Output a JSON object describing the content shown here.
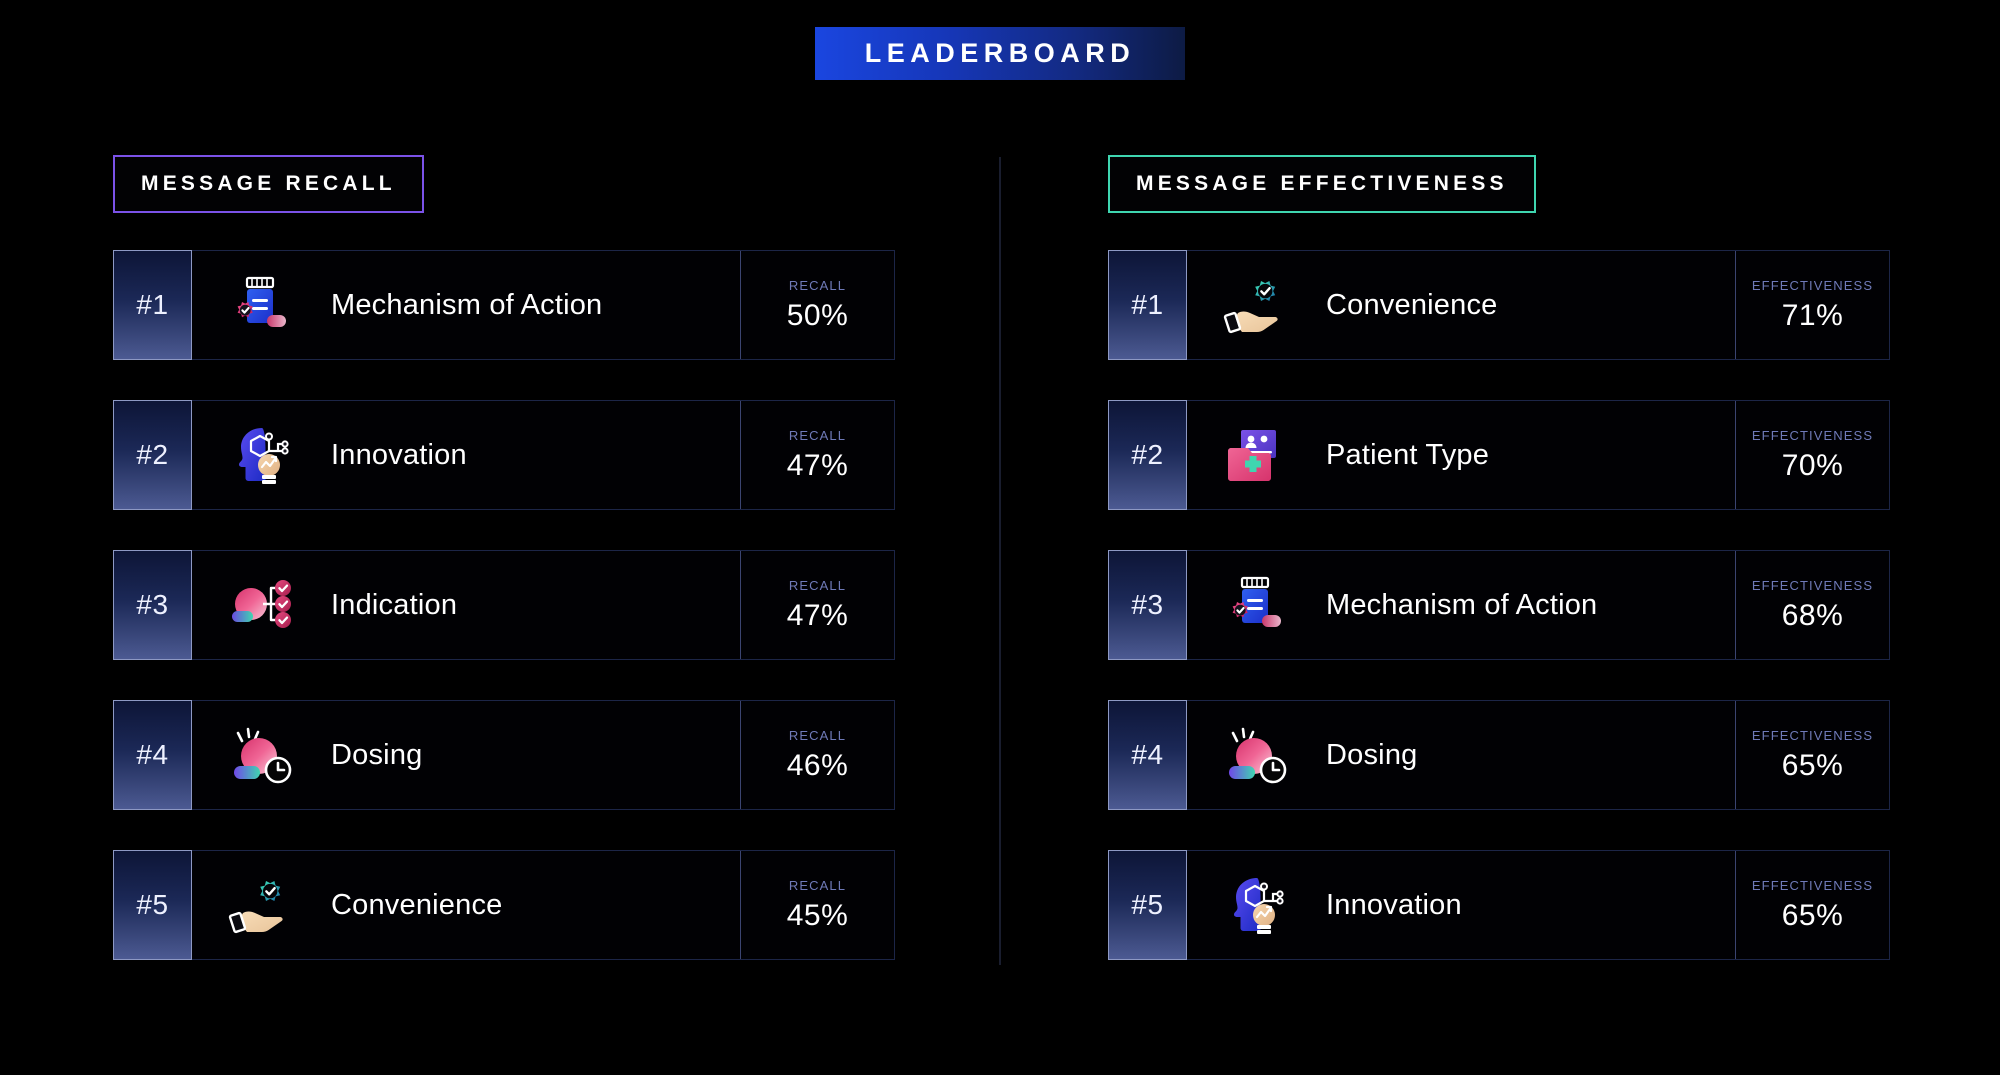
{
  "header": {
    "title": "LEADERBOARD",
    "title_gradient_from": "#1a46e0",
    "title_gradient_to": "#0d1b44"
  },
  "divider": {
    "name": "center-divider",
    "color": "#191d2e"
  },
  "columns": [
    {
      "id": "message-recall",
      "heading": "MESSAGE RECALL",
      "accent": "#7b52e8",
      "metric_label": "RECALL",
      "rows": [
        {
          "rank": "#1",
          "label": "Mechanism of Action",
          "icon": "pill-bottle-gear-icon",
          "metric_label": "RECALL",
          "value": "50%"
        },
        {
          "rank": "#2",
          "label": "Innovation",
          "icon": "head-network-bulb-icon",
          "metric_label": "RECALL",
          "value": "47%"
        },
        {
          "rank": "#3",
          "label": "Indication",
          "icon": "sphere-checklist-icon",
          "metric_label": "RECALL",
          "value": "47%"
        },
        {
          "rank": "#4",
          "label": "Dosing",
          "icon": "sphere-clock-icon",
          "metric_label": "RECALL",
          "value": "46%"
        },
        {
          "rank": "#5",
          "label": "Convenience",
          "icon": "hand-gear-check-icon",
          "metric_label": "RECALL",
          "value": "45%"
        }
      ]
    },
    {
      "id": "message-effectiveness",
      "heading": "MESSAGE EFFECTIVENESS",
      "accent": "#3fd6b0",
      "metric_label": "EFFECTIVENESS",
      "rows": [
        {
          "rank": "#1",
          "label": "Convenience",
          "icon": "hand-gear-check-icon",
          "metric_label": "EFFECTIVENESS",
          "value": "71%"
        },
        {
          "rank": "#2",
          "label": "Patient Type",
          "icon": "patient-folder-icon",
          "metric_label": "EFFECTIVENESS",
          "value": "70%"
        },
        {
          "rank": "#3",
          "label": "Mechanism of Action",
          "icon": "pill-bottle-gear-icon",
          "metric_label": "EFFECTIVENESS",
          "value": "68%"
        },
        {
          "rank": "#4",
          "label": "Dosing",
          "icon": "sphere-clock-icon",
          "metric_label": "EFFECTIVENESS",
          "value": "65%"
        },
        {
          "rank": "#5",
          "label": "Innovation",
          "icon": "head-network-bulb-icon",
          "metric_label": "EFFECTIVENESS",
          "value": "65%"
        }
      ]
    }
  ]
}
